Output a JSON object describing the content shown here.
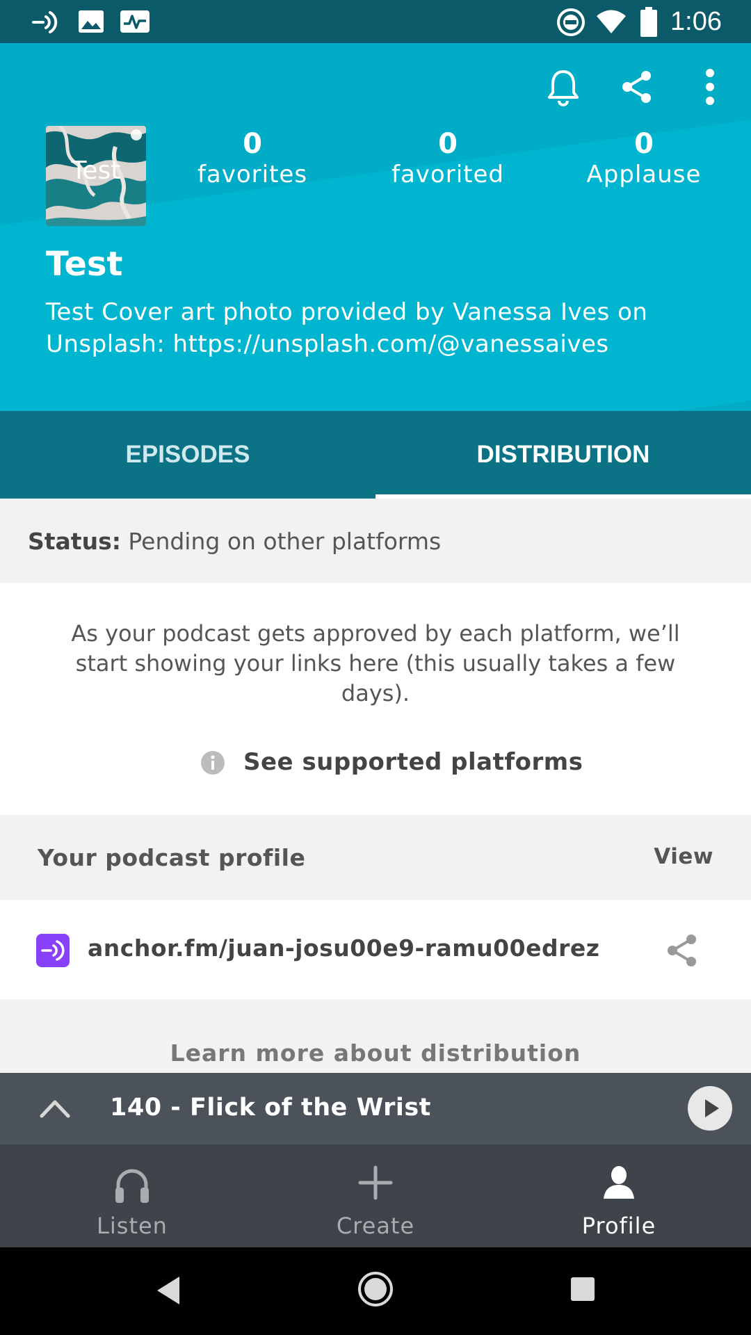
{
  "status_bar": {
    "time": "1:06"
  },
  "header": {
    "cover_text": "Test",
    "stats": [
      {
        "value": "0",
        "label": "favorites"
      },
      {
        "value": "0",
        "label": "favorited"
      },
      {
        "value": "0",
        "label": "Applause"
      }
    ],
    "title": "Test",
    "description": "Test Cover art photo provided by Vanessa Ives on Unsplash: https://unsplash.com/@vanessaives"
  },
  "tabs": [
    {
      "label": "EPISODES",
      "active": false
    },
    {
      "label": "DISTRIBUTION",
      "active": true
    }
  ],
  "distribution": {
    "status_label": "Status:",
    "status_value": "Pending on other platforms",
    "notice": "As your podcast gets approved by each platform, we’ll start showing your links here (this usually takes a few days).",
    "supported_link": "See supported platforms",
    "profile_title": "Your podcast profile",
    "profile_view": "View",
    "profile_url": "anchor.fm/juan-josu00e9-ramu00edrez",
    "learn_more": "Learn more about distribution"
  },
  "player": {
    "episode": "140 - Flick of the Wrist"
  },
  "bottom_nav": [
    {
      "label": "Listen",
      "icon": "headphones-icon",
      "active": false
    },
    {
      "label": "Create",
      "icon": "plus-icon",
      "active": false
    },
    {
      "label": "Profile",
      "icon": "person-icon",
      "active": true
    }
  ],
  "colors": {
    "header": "#00acc6",
    "tabs": "#0b7385",
    "status_bar": "#0a5a6a",
    "anchor_purple": "#8940fa",
    "player": "#4c525a",
    "nav": "#3f444b"
  }
}
